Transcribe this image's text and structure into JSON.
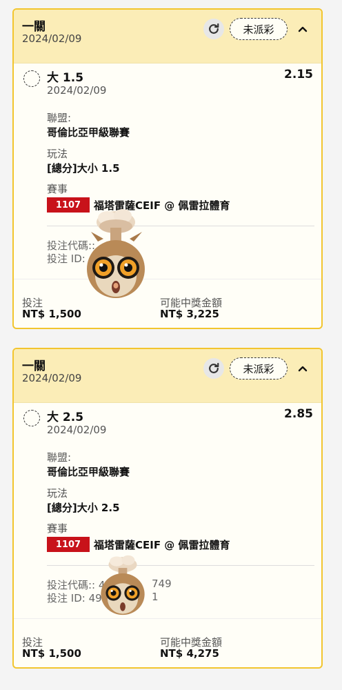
{
  "cards": [
    {
      "header": {
        "title": "一關",
        "date": "2024/02/09",
        "status": "未派彩"
      },
      "selection": {
        "name": "大 1.5",
        "date": "2024/02/09",
        "odds": "2.15"
      },
      "league": {
        "label": "聯盟:",
        "value": "哥倫比亞甲級聯賽"
      },
      "market": {
        "label": "玩法",
        "value": "[總分]大小 1.5"
      },
      "event": {
        "label": "賽事",
        "id": "1107",
        "name": "福塔雷薩CEIF @ 佩雷拉體育"
      },
      "codes": {
        "bet_code": "投注代碼::",
        "bet_id": "投注 ID: 4"
      },
      "stake": {
        "label": "投注",
        "value": "NT$ 1,500"
      },
      "potential": {
        "label": "可能中獎金額",
        "value": "NT$ 3,225"
      }
    },
    {
      "header": {
        "title": "一關",
        "date": "2024/02/09",
        "status": "未派彩"
      },
      "selection": {
        "name": "大 2.5",
        "date": "2024/02/09",
        "odds": "2.85"
      },
      "league": {
        "label": "聯盟:",
        "value": "哥倫比亞甲級聯賽"
      },
      "market": {
        "label": "玩法",
        "value": "[總分]大小 2.5"
      },
      "event": {
        "label": "賽事",
        "id": "1107",
        "name": "福塔雷薩CEIF @ 佩雷拉體育"
      },
      "codes": {
        "bet_code": "投注代碼:: 4",
        "bet_code_tail": "749",
        "bet_id": "投注 ID: 49",
        "bet_id_tail": "1"
      },
      "stake": {
        "label": "投注",
        "value": "NT$ 1,500"
      },
      "potential": {
        "label": "可能中獎金額",
        "value": "NT$ 4,275"
      }
    }
  ],
  "icons": {
    "refresh": "refresh-icon",
    "collapse": "chevron-up-icon",
    "selection": "dashed-circle-icon",
    "sticker": "exploding-head-owl-sticker"
  },
  "colors": {
    "card_border": "#f2c52e",
    "card_header_bg": "#fbedb7",
    "event_badge": "#c8121a"
  }
}
